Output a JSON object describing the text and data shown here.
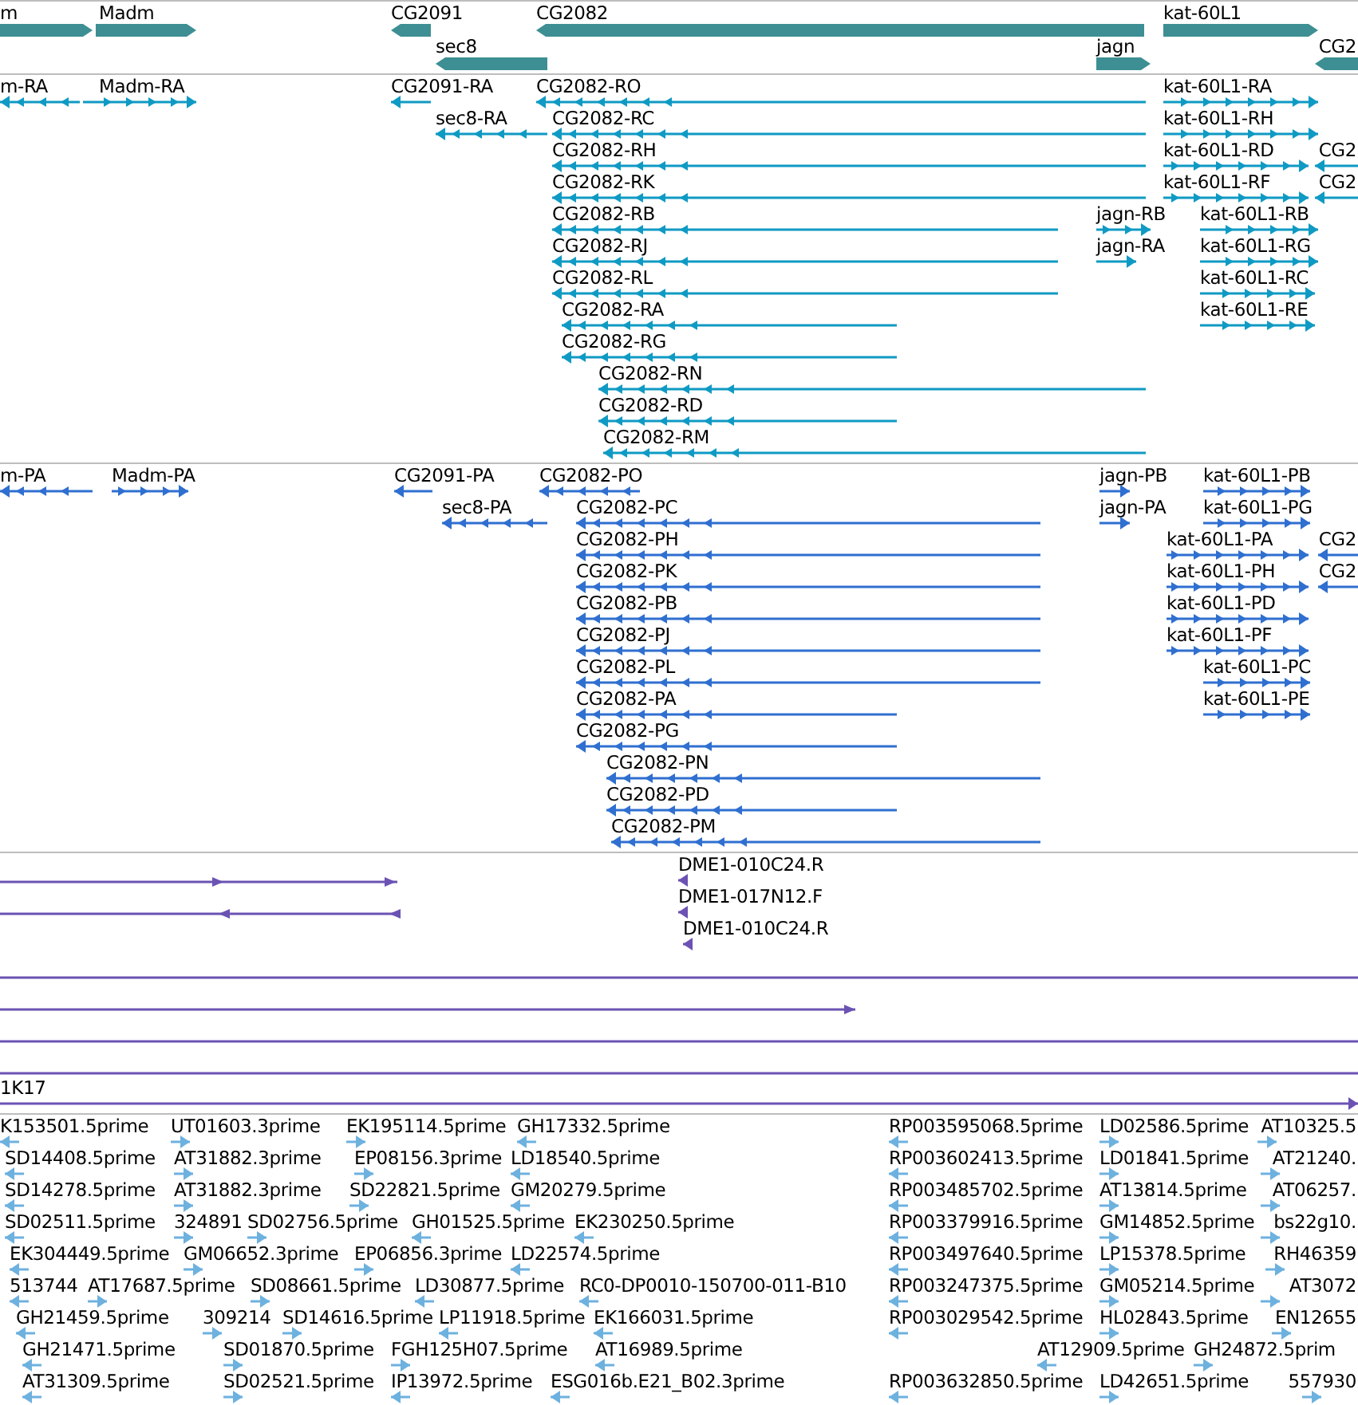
{
  "tracks": [
    {
      "kind": "genes",
      "features": [
        {
          "label": "m",
          "forward": true
        },
        {
          "label": "Madm",
          "forward": true
        },
        {
          "label": "CG2091",
          "forward": false
        },
        {
          "label": "CG2082",
          "forward": false
        },
        {
          "label": "kat-60L1",
          "forward": true
        },
        {
          "label": "sec8",
          "forward": false
        },
        {
          "label": "jagn",
          "forward": true
        },
        {
          "label": "CG2",
          "forward": false
        }
      ]
    },
    {
      "kind": "transcripts",
      "features": [
        {
          "label": "m-RA",
          "forward": false
        },
        {
          "label": "Madm-RA",
          "forward": true
        },
        {
          "label": "CG2091-RA",
          "forward": false
        },
        {
          "label": "CG2082-RO",
          "forward": false
        },
        {
          "label": "kat-60L1-RA",
          "forward": true
        },
        {
          "label": "sec8-RA",
          "forward": false
        },
        {
          "label": "CG2082-RC",
          "forward": false
        },
        {
          "label": "kat-60L1-RH",
          "forward": true
        },
        {
          "label": "CG2082-RH",
          "forward": false
        },
        {
          "label": "kat-60L1-RD",
          "forward": true
        },
        {
          "label": "CG2",
          "forward": false
        },
        {
          "label": "CG2082-RK",
          "forward": false
        },
        {
          "label": "kat-60L1-RF",
          "forward": true
        },
        {
          "label": "CG2",
          "forward": false
        },
        {
          "label": "CG2082-RB",
          "forward": false
        },
        {
          "label": "jagn-RB",
          "forward": true
        },
        {
          "label": "kat-60L1-RB",
          "forward": true
        },
        {
          "label": "CG2082-RJ",
          "forward": false
        },
        {
          "label": "jagn-RA",
          "forward": true
        },
        {
          "label": "kat-60L1-RG",
          "forward": true
        },
        {
          "label": "CG2082-RL",
          "forward": false
        },
        {
          "label": "kat-60L1-RC",
          "forward": true
        },
        {
          "label": "CG2082-RA",
          "forward": false
        },
        {
          "label": "kat-60L1-RE",
          "forward": true
        },
        {
          "label": "CG2082-RG",
          "forward": false
        },
        {
          "label": "CG2082-RN",
          "forward": false
        },
        {
          "label": "CG2082-RD",
          "forward": false
        },
        {
          "label": "CG2082-RM",
          "forward": false
        }
      ]
    },
    {
      "kind": "proteins",
      "features": [
        {
          "label": "m-PA",
          "forward": false
        },
        {
          "label": "Madm-PA",
          "forward": true
        },
        {
          "label": "CG2091-PA",
          "forward": false
        },
        {
          "label": "CG2082-PO",
          "forward": false
        },
        {
          "label": "jagn-PB",
          "forward": true
        },
        {
          "label": "kat-60L1-PB",
          "forward": true
        },
        {
          "label": "sec8-PA",
          "forward": false
        },
        {
          "label": "CG2082-PC",
          "forward": false
        },
        {
          "label": "jagn-PA",
          "forward": true
        },
        {
          "label": "kat-60L1-PG",
          "forward": true
        },
        {
          "label": "CG2082-PH",
          "forward": false
        },
        {
          "label": "kat-60L1-PA",
          "forward": true
        },
        {
          "label": "CG2",
          "forward": false
        },
        {
          "label": "CG2082-PK",
          "forward": false
        },
        {
          "label": "kat-60L1-PH",
          "forward": true
        },
        {
          "label": "CG2",
          "forward": false
        },
        {
          "label": "CG2082-PB",
          "forward": false
        },
        {
          "label": "kat-60L1-PD",
          "forward": true
        },
        {
          "label": "CG2082-PJ",
          "forward": false
        },
        {
          "label": "kat-60L1-PF",
          "forward": true
        },
        {
          "label": "CG2082-PL",
          "forward": false
        },
        {
          "label": "kat-60L1-PC",
          "forward": true
        },
        {
          "label": "CG2082-PA",
          "forward": false
        },
        {
          "label": "kat-60L1-PE",
          "forward": true
        },
        {
          "label": "CG2082-PG",
          "forward": false
        },
        {
          "label": "CG2082-PN",
          "forward": false
        },
        {
          "label": "CG2082-PD",
          "forward": false
        },
        {
          "label": "CG2082-PM",
          "forward": false
        }
      ]
    },
    {
      "kind": "clones",
      "features": [
        {
          "label": "DME1-010C24.R",
          "forward": false
        },
        {
          "label": "DME1-017N12.F",
          "forward": false
        },
        {
          "label": "DME1-010C24.R",
          "forward": false
        },
        {
          "label": "1K17",
          "forward": true
        }
      ]
    },
    {
      "kind": "ests",
      "features": [
        {
          "label": "K153501.5prime",
          "forward": false
        },
        {
          "label": "UT01603.3prime",
          "forward": true
        },
        {
          "label": "EK195114.5prime",
          "forward": true
        },
        {
          "label": "GH17332.5prime",
          "forward": false
        },
        {
          "label": "RP003595068.5prime",
          "forward": false
        },
        {
          "label": "LD02586.5prime",
          "forward": true
        },
        {
          "label": "AT10325.5",
          "forward": true
        },
        {
          "label": "SD14408.5prime",
          "forward": false
        },
        {
          "label": "AT31882.3prime",
          "forward": true
        },
        {
          "label": "EP08156.3prime",
          "forward": true
        },
        {
          "label": "LD18540.5prime",
          "forward": false
        },
        {
          "label": "RP003602413.5prime",
          "forward": false
        },
        {
          "label": "LD01841.5prime",
          "forward": true
        },
        {
          "label": "AT21240.",
          "forward": true
        },
        {
          "label": "SD14278.5prime",
          "forward": false
        },
        {
          "label": "AT31882.3prime",
          "forward": true
        },
        {
          "label": "SD22821.5prime",
          "forward": true
        },
        {
          "label": "GM20279.5prime",
          "forward": false
        },
        {
          "label": "RP003485702.5prime",
          "forward": false
        },
        {
          "label": "AT13814.5prime",
          "forward": true
        },
        {
          "label": "AT06257.",
          "forward": true
        },
        {
          "label": "SD02511.5prime",
          "forward": false
        },
        {
          "label": "324891",
          "forward": true
        },
        {
          "label": "SD02756.5prime",
          "forward": true
        },
        {
          "label": "GH01525.5prime",
          "forward": false
        },
        {
          "label": "EK230250.5prime",
          "forward": false
        },
        {
          "label": "RP003379916.5prime",
          "forward": false
        },
        {
          "label": "GM14852.5prime",
          "forward": true
        },
        {
          "label": "bs22g10.",
          "forward": true
        },
        {
          "label": "EK304449.5prime",
          "forward": false
        },
        {
          "label": "GM06652.3prime",
          "forward": true
        },
        {
          "label": "EP06856.3prime",
          "forward": true
        },
        {
          "label": "LD22574.5prime",
          "forward": false
        },
        {
          "label": "RP003497640.5prime",
          "forward": false
        },
        {
          "label": "LP15378.5prime",
          "forward": true
        },
        {
          "label": "RH46359",
          "forward": true
        },
        {
          "label": "513744",
          "forward": false
        },
        {
          "label": "AT17687.5prime",
          "forward": true
        },
        {
          "label": "SD08661.5prime",
          "forward": true
        },
        {
          "label": "LD30877.5prime",
          "forward": false
        },
        {
          "label": "RC0-DP0010-150700-011-B10",
          "forward": false
        },
        {
          "label": "RP003247375.5prime",
          "forward": false
        },
        {
          "label": "GM05214.5prime",
          "forward": true
        },
        {
          "label": "AT3072",
          "forward": true
        },
        {
          "label": "GH21459.5prime",
          "forward": false
        },
        {
          "label": "309214",
          "forward": true
        },
        {
          "label": "SD14616.5prime",
          "forward": true
        },
        {
          "label": "LP11918.5prime",
          "forward": false
        },
        {
          "label": "EK166031.5prime",
          "forward": false
        },
        {
          "label": "RP003029542.5prime",
          "forward": false
        },
        {
          "label": "HL02843.5prime",
          "forward": true
        },
        {
          "label": "EN12655",
          "forward": true
        },
        {
          "label": "GH21471.5prime",
          "forward": false
        },
        {
          "label": "SD01870.5prime",
          "forward": true
        },
        {
          "label": "FGH125H07.5prime",
          "forward": true
        },
        {
          "label": "AT16989.5prime",
          "forward": false
        },
        {
          "label": "AT12909.5prime",
          "forward": false
        },
        {
          "label": "GH24872.5prim",
          "forward": true
        },
        {
          "label": "AT31309.5prime",
          "forward": false
        },
        {
          "label": "SD02521.5prime",
          "forward": true
        },
        {
          "label": "IP13972.5prime",
          "forward": false
        },
        {
          "label": "ESG016b.E21_B02.3prime",
          "forward": false
        },
        {
          "label": "RP003632850.5prime",
          "forward": false
        },
        {
          "label": "LD42651.5prime",
          "forward": true
        },
        {
          "label": "557930",
          "forward": true
        }
      ]
    }
  ]
}
